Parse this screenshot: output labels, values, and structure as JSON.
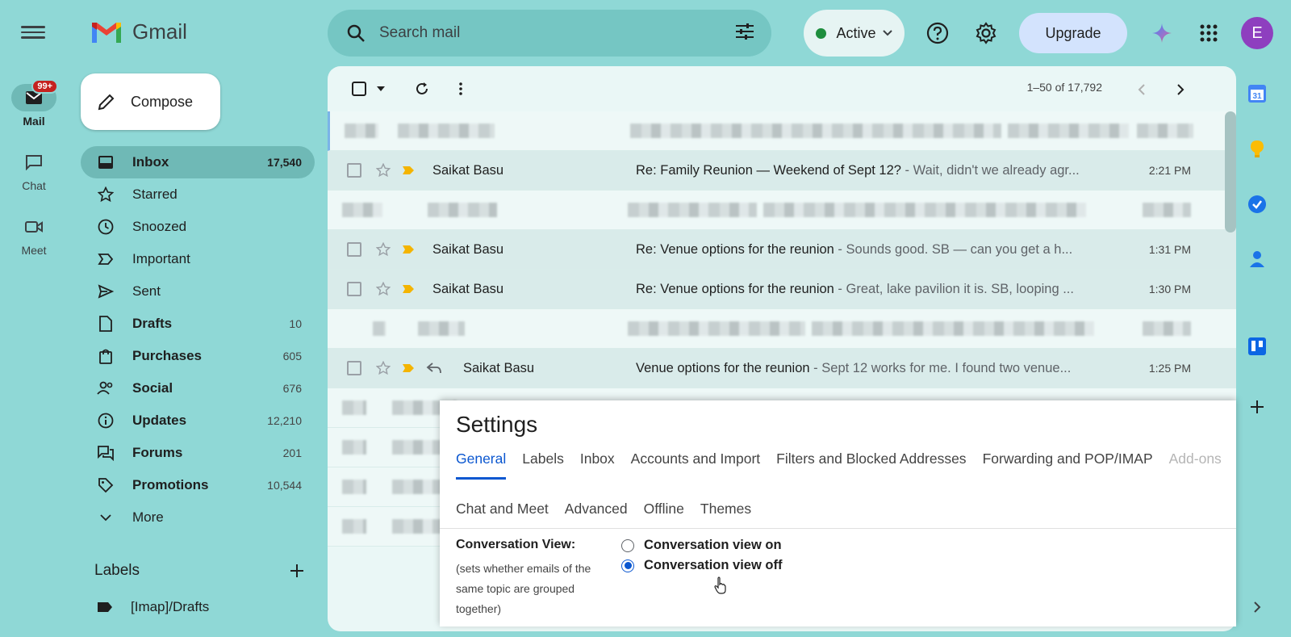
{
  "app": {
    "logo_text": "Gmail"
  },
  "rail": {
    "items": [
      {
        "label": "Mail",
        "badge": "99+"
      },
      {
        "label": "Chat"
      },
      {
        "label": "Meet"
      }
    ]
  },
  "search": {
    "placeholder": "Search mail"
  },
  "status": {
    "label": "Active",
    "color": "#1e8e3e"
  },
  "header": {
    "upgrade_label": "Upgrade",
    "avatar_initial": "E"
  },
  "compose": {
    "label": "Compose"
  },
  "nav": {
    "items": [
      {
        "label": "Inbox",
        "count": "17,540",
        "icon": "inbox-icon"
      },
      {
        "label": "Starred",
        "count": "",
        "icon": "star-icon"
      },
      {
        "label": "Snoozed",
        "count": "",
        "icon": "clock-icon"
      },
      {
        "label": "Important",
        "count": "",
        "icon": "important-icon"
      },
      {
        "label": "Sent",
        "count": "",
        "icon": "send-icon"
      },
      {
        "label": "Drafts",
        "count": "10",
        "icon": "draft-icon"
      },
      {
        "label": "Purchases",
        "count": "605",
        "icon": "shopping-bag-icon"
      },
      {
        "label": "Social",
        "count": "676",
        "icon": "people-icon"
      },
      {
        "label": "Updates",
        "count": "12,210",
        "icon": "info-icon"
      },
      {
        "label": "Forums",
        "count": "201",
        "icon": "forum-icon"
      },
      {
        "label": "Promotions",
        "count": "10,544",
        "icon": "tag-icon"
      },
      {
        "label": "More",
        "count": "",
        "icon": "chevron-down-icon"
      }
    ]
  },
  "labels": {
    "heading": "Labels",
    "items": [
      "[Imap]/Drafts"
    ]
  },
  "mail_list": {
    "pager": "1–50 of 17,792",
    "rows": [
      {
        "sender": "Saikat Basu",
        "subject": "Re: Family Reunion — Weekend of Sept 12?",
        "snippet": " - Wait, didn't we already agr...",
        "time": "2:21 PM"
      },
      {
        "sender": "Saikat Basu",
        "subject": "Re: Venue options for the reunion",
        "snippet": " - Sounds good. SB — can you get a h...",
        "time": "1:31 PM"
      },
      {
        "sender": "Saikat Basu",
        "subject": "Re: Venue options for the reunion",
        "snippet": " - Great, lake pavilion it is. SB, looping ...",
        "time": "1:30 PM"
      },
      {
        "sender": "Saikat Basu",
        "subject": "Venue options for the reunion",
        "snippet": " - Sept 12 works for me. I found two venue...",
        "time": "1:25 PM"
      }
    ]
  },
  "settings": {
    "title": "Settings",
    "tabs_row1": [
      "General",
      "Labels",
      "Inbox",
      "Accounts and Import",
      "Filters and Blocked Addresses",
      "Forwarding and POP/IMAP",
      "Add-ons"
    ],
    "tabs_row2": [
      "Chat and Meet",
      "Advanced",
      "Offline",
      "Themes"
    ],
    "conversation_view": {
      "label": "Conversation View:",
      "description": "(sets whether emails of the same topic are grouped together)",
      "option_on": "Conversation view on",
      "option_off": "Conversation view off",
      "selected": "off"
    }
  },
  "side_panel": {
    "calendar_day": "31"
  }
}
